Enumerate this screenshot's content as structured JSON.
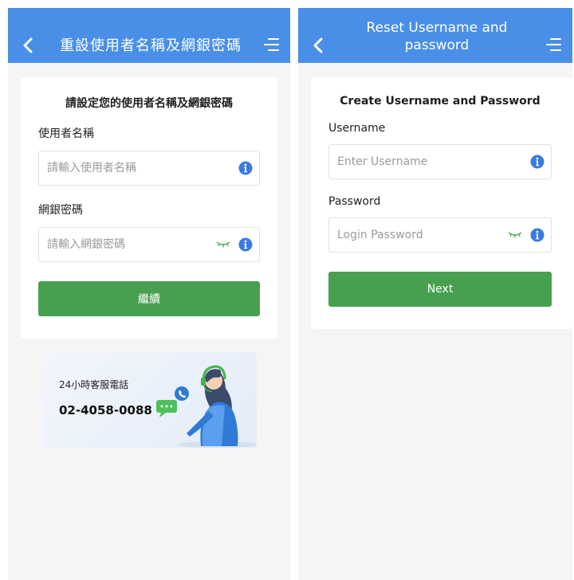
{
  "screens": {
    "zh": {
      "header_title": "重設使用者名稱及網銀密碼",
      "card_title": "請設定您的使用者名稱及網銀密碼",
      "username_label": "使用者名稱",
      "username_placeholder": "請輸入使用者名稱",
      "password_label": "網銀密碼",
      "password_placeholder": "請輸入網銀密碼",
      "continue_label": "繼續",
      "support_label": "24小時客服電話",
      "support_phone": "02-4058-0088"
    },
    "en": {
      "header_title": "Reset Username and password",
      "card_title": "Create Username and Password",
      "username_label": "Username",
      "username_placeholder": "Enter Username",
      "password_label": "Password",
      "password_placeholder": "Login Password",
      "next_label": "Next"
    }
  },
  "icons": {
    "back": "chevron-left-icon",
    "menu": "menu-icon",
    "info": "info-icon",
    "eye": "eye-closed-icon",
    "headset": "headset-agent-illustration",
    "chat": "chat-bubble-icon",
    "phone": "phone-icon"
  },
  "colors": {
    "header": "#4a8fe7",
    "primary_button": "#47a04f",
    "info_icon": "#3b7be0",
    "eye_icon": "#3fa64a",
    "background": "#f5f5f5"
  }
}
